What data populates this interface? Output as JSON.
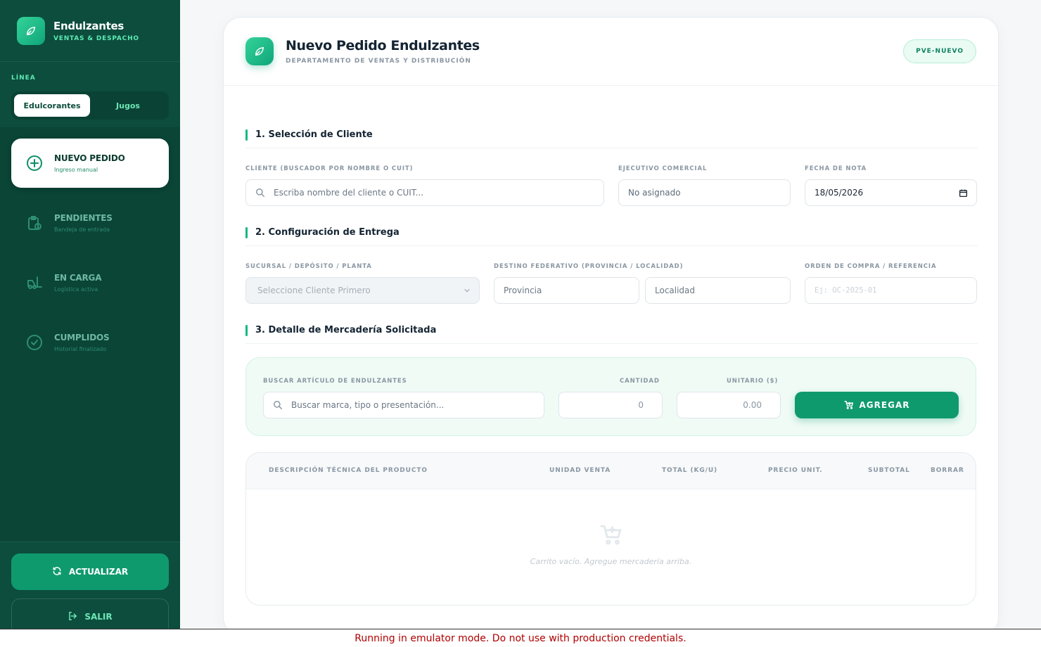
{
  "brand": {
    "title": "Endulzantes",
    "subtitle": "VENTAS & DESPACHO",
    "icon": "leaf-icon"
  },
  "linea": {
    "label": "LÍNEA",
    "options": [
      "Edulcorantes",
      "Jugos"
    ],
    "selected": "Edulcorantes"
  },
  "nav": [
    {
      "title": "NUEVO PEDIDO",
      "subtitle": "Ingreso manual",
      "icon": "plus-circle-icon",
      "active": true
    },
    {
      "title": "PENDIENTES",
      "subtitle": "Bandeja de entrada",
      "icon": "clipboard-clock-icon",
      "active": false
    },
    {
      "title": "EN CARGA",
      "subtitle": "Logística activa",
      "icon": "forklift-icon",
      "active": false
    },
    {
      "title": "CUMPLIDOS",
      "subtitle": "Historial finalizado",
      "icon": "check-circle-icon",
      "active": false
    }
  ],
  "actions": {
    "refresh": "ACTUALIZAR",
    "exit": "SALIR"
  },
  "header": {
    "title": "Nuevo Pedido Endulzantes",
    "subtitle": "DEPARTAMENTO DE VENTAS Y DISTRIBUCIÓN",
    "badge": "PVE-NUEVO"
  },
  "section1": {
    "title": "1. Selección de Cliente",
    "client_label": "CLIENTE (BUSCADOR POR NOMBRE O CUIT)",
    "client_placeholder": "Escriba nombre del cliente o CUIT...",
    "exec_label": "EJECUTIVO COMERCIAL",
    "exec_value": "No asignado",
    "date_label": "FECHA DE NOTA",
    "date_value": "18/05/2026"
  },
  "section2": {
    "title": "2. Configuración de Entrega",
    "branch_label": "SUCURSAL / DEPÓSITO / PLANTA",
    "branch_value": "Seleccione Cliente Primero",
    "dest_label": "DESTINO FEDERATIVO (PROVINCIA / LOCALIDAD)",
    "province_placeholder": "Provincia",
    "locality_placeholder": "Localidad",
    "po_label": "ORDEN DE COMPRA / REFERENCIA",
    "po_placeholder": "Ej: OC-2025-01"
  },
  "section3": {
    "title": "3. Detalle de Mercadería Solicitada",
    "search_label": "BUSCAR ARTÍCULO DE ENDULZANTES",
    "search_placeholder": "Buscar marca, tipo o presentación...",
    "qty_label": "CANTIDAD",
    "qty_value": "0",
    "unit_label": "UNITARIO ($)",
    "unit_value": "0.00",
    "add_button": "AGREGAR"
  },
  "table": {
    "columns": [
      "DESCRIPCIÓN TÉCNICA DEL PRODUCTO",
      "UNIDAD VENTA",
      "TOTAL (KG/U)",
      "PRECIO UNIT.",
      "SUBTOTAL",
      "BORRAR"
    ],
    "empty_message": "Carrito vacío. Agregue mercadería arriba."
  },
  "footer_banner": "Running in emulator mode. Do not use with production credentials.",
  "colors": {
    "sidebar": "#0c4d3d",
    "accent": "#0f9a6e",
    "badge_text": "#11815e"
  }
}
